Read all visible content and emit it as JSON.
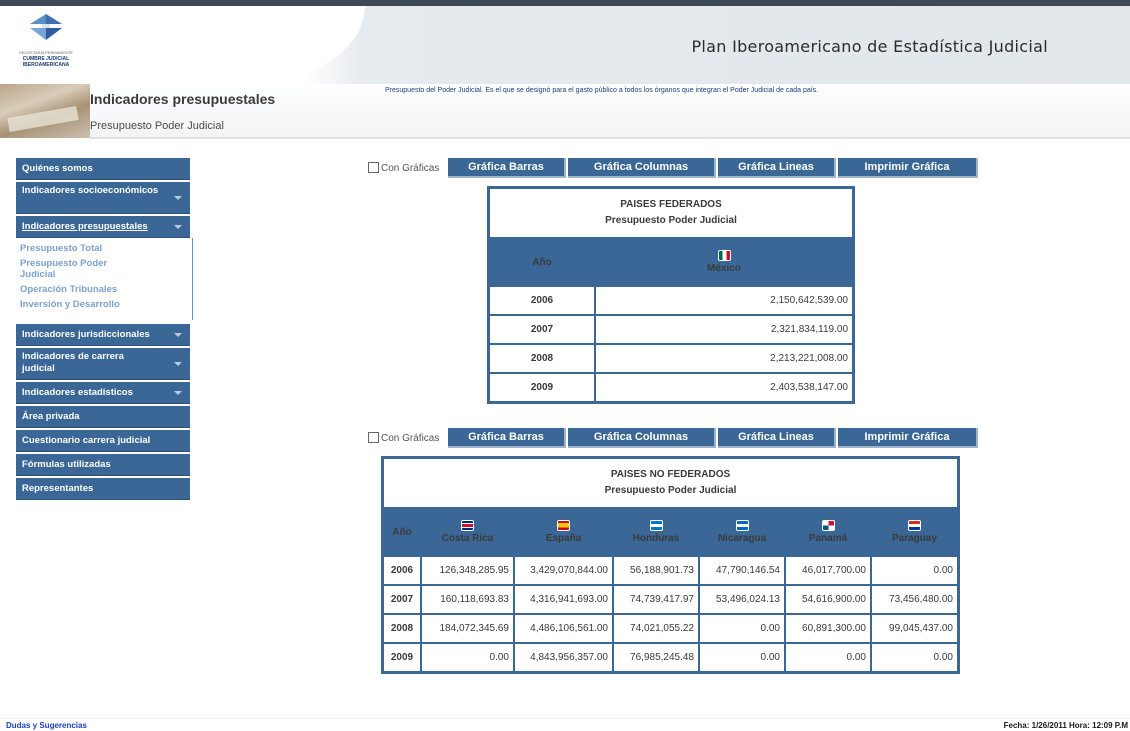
{
  "header": {
    "site_title": "Plan Iberoamericano de Estadística Judicial",
    "logo_small": "SECRETARÍA PERMANENTE",
    "logo_line1": "CUMBRE JUDICIAL",
    "logo_line2": "IBEROAMERICANA"
  },
  "page": {
    "section_title": "Indicadores presupuestales",
    "section_subtitle": "Presupuesto Poder Judicial",
    "description": "Presupuesto del Poder Judicial. Es el que se designó para el gasto público a todos los órganos que integran el Poder Judicial de cada país."
  },
  "sidebar": {
    "items": [
      {
        "label": "Quiénes somos"
      },
      {
        "label": "Indicadores socioeconómicos"
      },
      {
        "label": "Indicadores presupuestales"
      },
      {
        "label": "Indicadores jurisdiccionales"
      },
      {
        "label": "Indicadores de carrera judicial"
      },
      {
        "label": "Indicadores estadísticos"
      },
      {
        "label": "Área privada"
      },
      {
        "label": "Cuestionario carrera judicial"
      },
      {
        "label": "Fórmulas utilizadas"
      },
      {
        "label": "Representantes"
      }
    ],
    "submenu": [
      "Presupuesto Total",
      "Presupuesto Poder Judicial",
      "Operación Tribunales",
      "Inversión y Desarrollo"
    ]
  },
  "controls": {
    "checkbox_label": "Con Gráficas",
    "bar_chart": "Gráfica Barras",
    "column_chart": "Gráfica Columnas",
    "line_chart": "Gráfica Lineas",
    "print_chart": "Imprimir Gráfica"
  },
  "federados": {
    "title": "PAISES FEDERADOS",
    "subtitle": "Presupuesto Poder Judicial",
    "year_header": "Año",
    "countries": [
      {
        "name": "México",
        "flag": [
          "#006847",
          "#ffffff",
          "#ce1126"
        ]
      }
    ],
    "rows": [
      {
        "year": "2006",
        "values": [
          "2,150,642,539.00"
        ]
      },
      {
        "year": "2007",
        "values": [
          "2,321,834,119.00"
        ]
      },
      {
        "year": "2008",
        "values": [
          "2,213,221,008.00"
        ]
      },
      {
        "year": "2009",
        "values": [
          "2,403,538,147.00"
        ]
      }
    ]
  },
  "no_federados": {
    "title": "PAISES NO FEDERADOS",
    "subtitle": "Presupuesto Poder Judicial",
    "year_header": "Año",
    "countries": [
      {
        "name": "Costa Rica",
        "flag": [
          "#002b7f",
          "#ce1126",
          "#ffffff"
        ]
      },
      {
        "name": "España",
        "flag": [
          "#c60b1e",
          "#ffc400",
          "#c60b1e"
        ]
      },
      {
        "name": "Honduras",
        "flag": [
          "#0073cf",
          "#ffffff",
          "#0073cf"
        ]
      },
      {
        "name": "Nicaragua",
        "flag": [
          "#0067c6",
          "#ffffff",
          "#0067c6"
        ]
      },
      {
        "name": "Panamá",
        "flag": [
          "#d21034",
          "#ffffff",
          "#005293"
        ]
      },
      {
        "name": "Paraguay",
        "flag": [
          "#d52b1e",
          "#ffffff",
          "#0038a8"
        ]
      }
    ],
    "rows": [
      {
        "year": "2006",
        "values": [
          "126,348,285.95",
          "3,429,070,844.00",
          "56,188,901.73",
          "47,790,146.54",
          "46,017,700.00",
          "0.00"
        ]
      },
      {
        "year": "2007",
        "values": [
          "160,118,693.83",
          "4,316,941,693.00",
          "74,739,417.97",
          "53,496,024.13",
          "54,616,900.00",
          "73,456,480.00"
        ]
      },
      {
        "year": "2008",
        "values": [
          "184,072,345.69",
          "4,486,106,561.00",
          "74,021,055.22",
          "0.00",
          "60,891,300.00",
          "99,045,437.00"
        ]
      },
      {
        "year": "2009",
        "values": [
          "0.00",
          "4,843,956,357.00",
          "76,985,245.48",
          "0.00",
          "0.00",
          "0.00"
        ]
      }
    ]
  },
  "footer": {
    "left_link": "Dudas y Sugerencias",
    "right_text": "Fecha: 1/26/2011 Hora: 12:09 P.M"
  }
}
